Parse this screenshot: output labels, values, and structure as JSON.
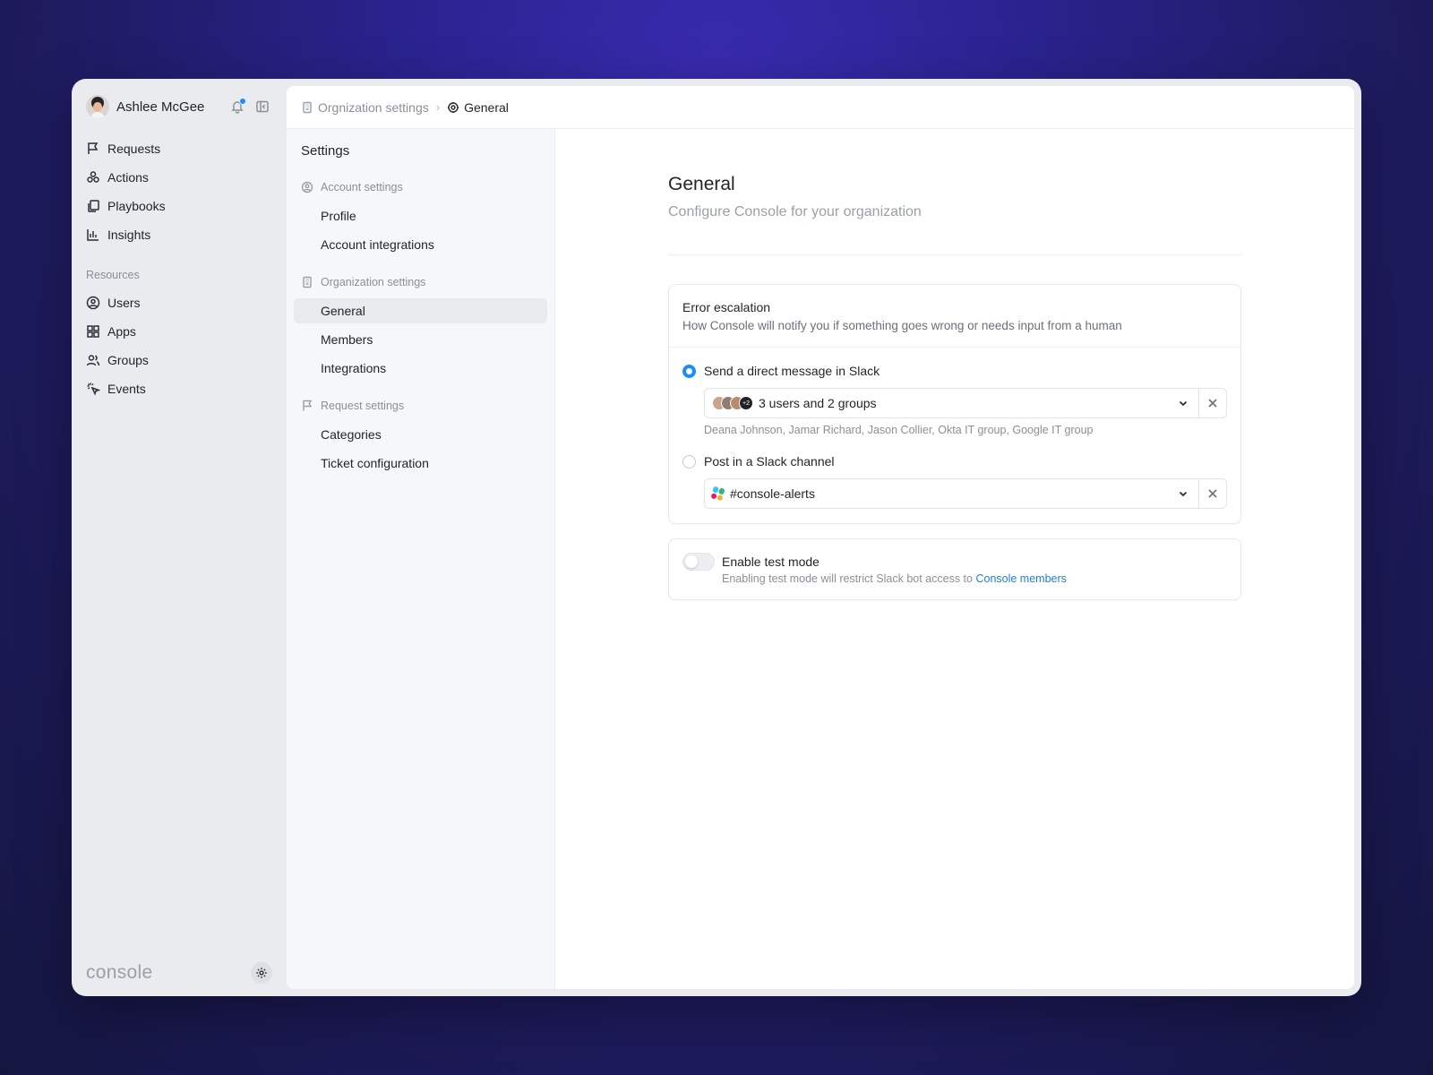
{
  "user": {
    "name": "Ashlee McGee"
  },
  "nav": {
    "main": [
      {
        "label": "Requests",
        "icon": "flag-icon"
      },
      {
        "label": "Actions",
        "icon": "actions-icon"
      },
      {
        "label": "Playbooks",
        "icon": "playbooks-icon"
      },
      {
        "label": "Insights",
        "icon": "chart-icon"
      }
    ],
    "resources_label": "Resources",
    "resources": [
      {
        "label": "Users",
        "icon": "user-circle-icon"
      },
      {
        "label": "Apps",
        "icon": "grid-icon"
      },
      {
        "label": "Groups",
        "icon": "users-icon"
      },
      {
        "label": "Events",
        "icon": "cursor-click-icon"
      }
    ],
    "logo": "console"
  },
  "breadcrumb": {
    "parent": "Orgnization settings",
    "current": "General"
  },
  "settings": {
    "title": "Settings",
    "account_label": "Account settings",
    "account_items": [
      "Profile",
      "Account integrations"
    ],
    "org_label": "Organization settings",
    "org_items": [
      "General",
      "Members",
      "Integrations"
    ],
    "request_label": "Request settings",
    "request_items": [
      "Categories",
      "Ticket configuration"
    ]
  },
  "page": {
    "title": "General",
    "subtitle": "Configure Console for your organization"
  },
  "escalation": {
    "title": "Error escalation",
    "description": "How Console will notify you if something goes wrong or needs input from a human",
    "option1_label": "Send a direct message in Slack",
    "option1_value": "3 users and 2 groups",
    "option1_more_badge": "+2",
    "option1_helper": "Deana Johnson, Jamar Richard, Jason Collier, Okta IT group, Google IT group",
    "option2_label": "Post in a Slack channel",
    "option2_value": "#console-alerts"
  },
  "test_mode": {
    "title": "Enable test mode",
    "description": "Enabling test mode will restrict Slack bot access to ",
    "link": "Console members"
  },
  "colors": {
    "accent": "#1d8cf8",
    "link": "#1d7fe0"
  }
}
